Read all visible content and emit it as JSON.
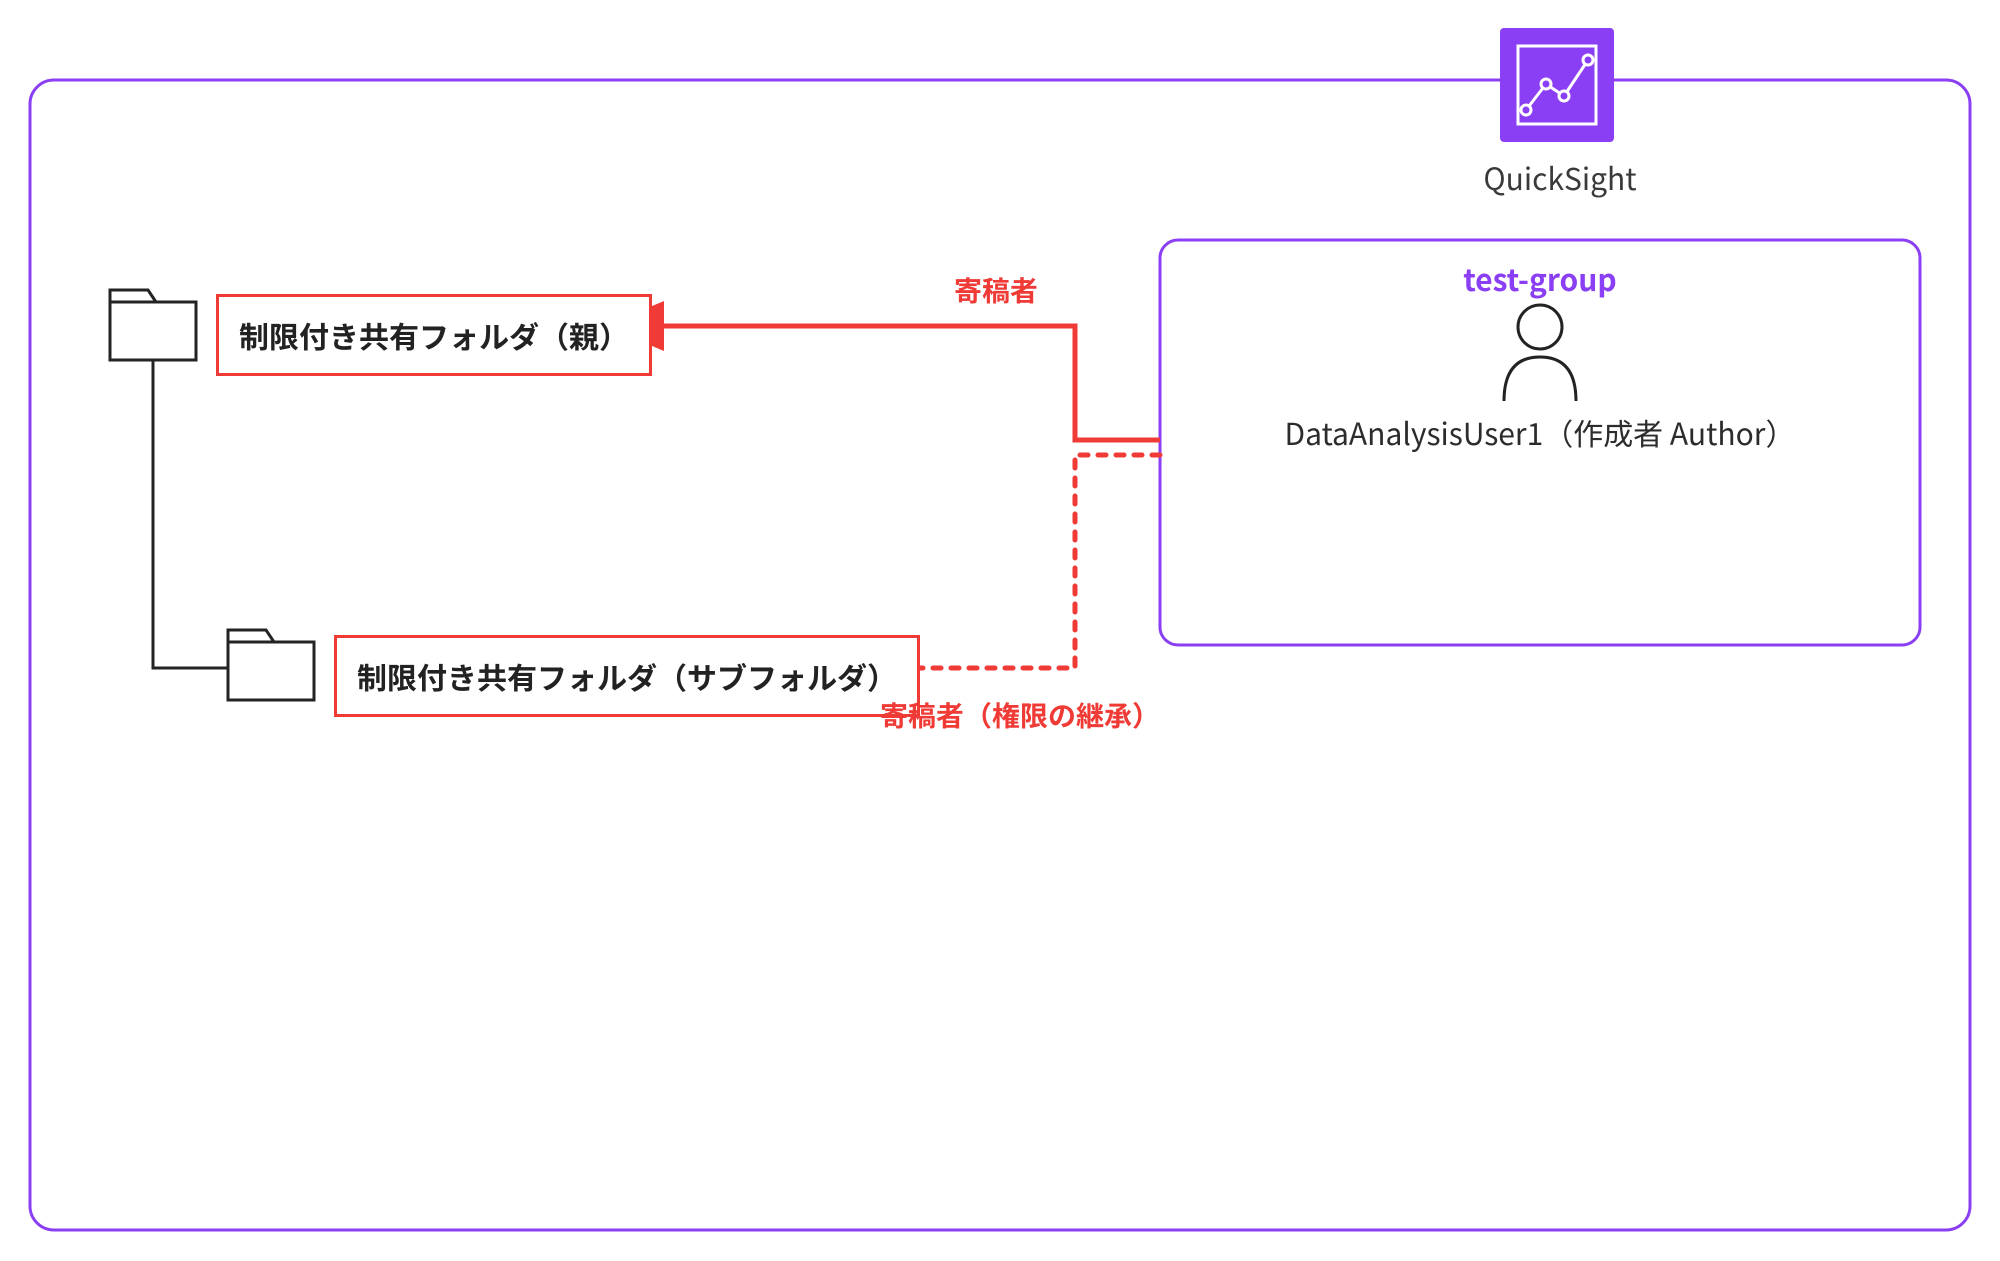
{
  "service": {
    "name": "QuickSight"
  },
  "group": {
    "name": "test-group",
    "user_label": "DataAnalysisUser1（作成者 Author）"
  },
  "folders": {
    "parent_label": "制限付き共有フォルダ（親）",
    "sub_label": "制限付き共有フォルダ（サブフォルダ）"
  },
  "arrows": {
    "to_parent_role": "寄稿者",
    "to_sub_role": "寄稿者（権限の継承）"
  },
  "colors": {
    "accent_purple": "#8B3FF5",
    "accent_red": "#EF3A35",
    "outline_dark": "#232323"
  }
}
